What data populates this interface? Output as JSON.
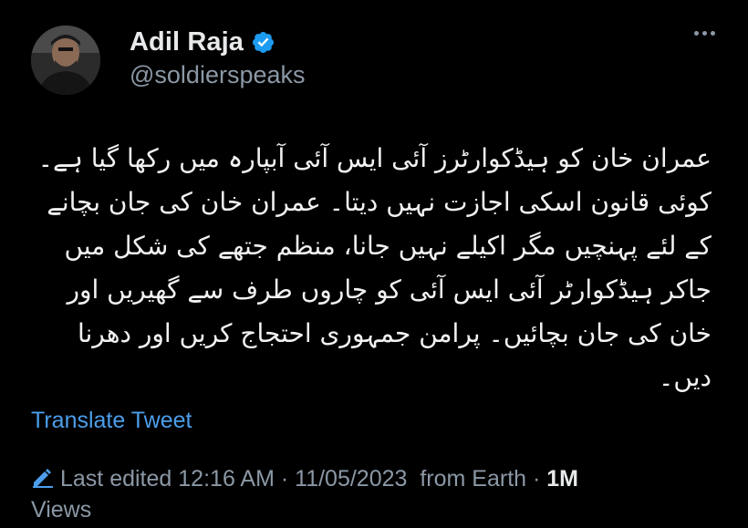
{
  "author": {
    "display_name": "Adil Raja",
    "handle": "@soldierspeaks",
    "verified": true
  },
  "tweet": {
    "text": "عمران خان کو ہیڈکوارٹرز آئی ایس آئی آبپارہ میں رکھا گیا ہے۔ کوئی قانون اسکی اجازت نہیں دیتا۔ عمران خان کی جان بچانے کے لئے پہنچیں مگر اکیلے نہیں جانا، منظم جتھے کی شکل میں جاکر ہیڈکوارٹر آئی ایس آئی کو چاروں طرف سے گھیریں اور خان کی جان بچائیں۔ پرامن جمہوری احتجاج کریں اور دھرنا دیں۔"
  },
  "actions": {
    "translate_label": "Translate Tweet"
  },
  "meta": {
    "edited_label": "Last edited",
    "time": "12:16 AM",
    "separator": "·",
    "date": "11/05/2023",
    "source": "from Earth",
    "views_count": "1M",
    "views_label": "Views"
  },
  "colors": {
    "background": "#000000",
    "text": "#e7e9ea",
    "muted": "#8b98a5",
    "link": "#4c9eeb",
    "verified": "#1d9bf0"
  },
  "icons": {
    "verified": "verified-badge-icon",
    "more": "more-options-icon",
    "edit": "pencil-edit-icon"
  }
}
